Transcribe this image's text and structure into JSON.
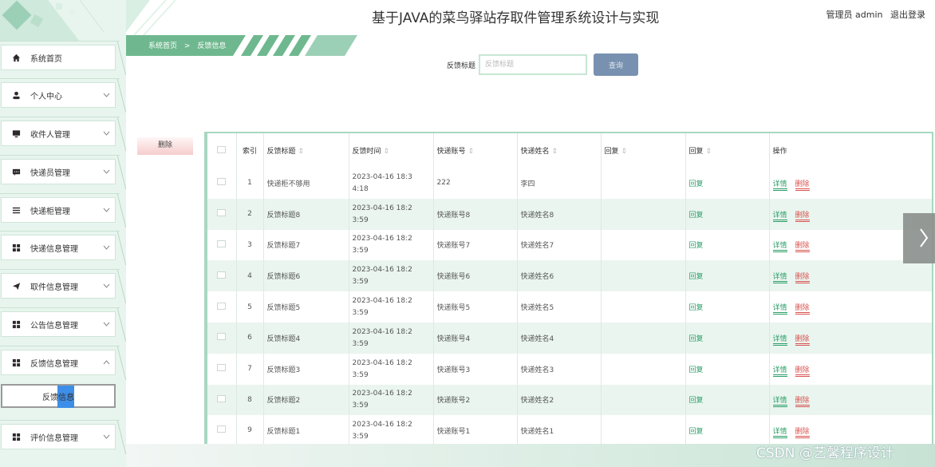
{
  "header": {
    "title": "基于JAVA的菜鸟驿站存取件管理系统设计与实现",
    "user_label": "管理员 admin",
    "logout": "退出登录"
  },
  "breadcrumb": {
    "home": "系统首页",
    "sep": ">",
    "current": "反馈信息"
  },
  "search": {
    "label": "反馈标题",
    "placeholder": "反馈标题",
    "button": "查询"
  },
  "delete_button": "删除",
  "sidebar": {
    "items": [
      {
        "label": "系统首页",
        "icon": "home-icon"
      },
      {
        "label": "个人中心",
        "icon": "user-icon"
      },
      {
        "label": "收件人管理",
        "icon": "monitor-icon"
      },
      {
        "label": "快递员管理",
        "icon": "chat-icon"
      },
      {
        "label": "快递柜管理",
        "icon": "list-icon"
      },
      {
        "label": "快递信息管理",
        "icon": "grid-icon"
      },
      {
        "label": "取件信息管理",
        "icon": "send-icon"
      },
      {
        "label": "公告信息管理",
        "icon": "grid-icon"
      },
      {
        "label": "反馈信息管理",
        "icon": "grid-icon"
      },
      {
        "label": "评价信息管理",
        "icon": "grid-icon"
      }
    ],
    "subitem": "反馈信息"
  },
  "table": {
    "headers": [
      "索引",
      "反馈标题",
      "反馈时间",
      "快递账号",
      "快递姓名",
      "回复",
      "回复",
      "操作"
    ],
    "rows": [
      {
        "idx": "1",
        "title": "快递柜不够用",
        "time1": "2023-04-16 18:3",
        "time2": "4:18",
        "acct": "222",
        "name": "李四",
        "reply": "回复"
      },
      {
        "idx": "2",
        "title": "反馈标题8",
        "time1": "2023-04-16 18:2",
        "time2": "3:59",
        "acct": "快递账号8",
        "name": "快递姓名8",
        "reply": "回复"
      },
      {
        "idx": "3",
        "title": "反馈标题7",
        "time1": "2023-04-16 18:2",
        "time2": "3:59",
        "acct": "快递账号7",
        "name": "快递姓名7",
        "reply": "回复"
      },
      {
        "idx": "4",
        "title": "反馈标题6",
        "time1": "2023-04-16 18:2",
        "time2": "3:59",
        "acct": "快递账号6",
        "name": "快递姓名6",
        "reply": "回复"
      },
      {
        "idx": "5",
        "title": "反馈标题5",
        "time1": "2023-04-16 18:2",
        "time2": "3:59",
        "acct": "快递账号5",
        "name": "快递姓名5",
        "reply": "回复"
      },
      {
        "idx": "6",
        "title": "反馈标题4",
        "time1": "2023-04-16 18:2",
        "time2": "3:59",
        "acct": "快递账号4",
        "name": "快递姓名4",
        "reply": "回复"
      },
      {
        "idx": "7",
        "title": "反馈标题3",
        "time1": "2023-04-16 18:2",
        "time2": "3:59",
        "acct": "快递账号3",
        "name": "快递姓名3",
        "reply": "回复"
      },
      {
        "idx": "8",
        "title": "反馈标题2",
        "time1": "2023-04-16 18:2",
        "time2": "3:59",
        "acct": "快递账号2",
        "name": "快递姓名2",
        "reply": "回复"
      },
      {
        "idx": "9",
        "title": "反馈标题1",
        "time1": "2023-04-16 18:2",
        "time2": "3:59",
        "acct": "快递账号1",
        "name": "快递姓名1",
        "reply": "回复"
      }
    ],
    "action_detail": "详情",
    "action_delete": "删除"
  },
  "watermark": "CSDN @艺馨程序设计",
  "colors": {
    "accent": "#2c9e68",
    "danger": "#d9534f",
    "query_button": "#7891b0",
    "sidebar_bg": "#e8f5ee"
  }
}
